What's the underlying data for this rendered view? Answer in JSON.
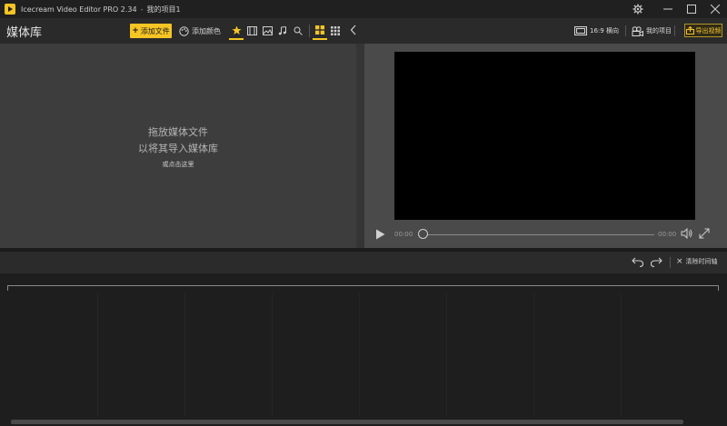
{
  "window": {
    "app_title": "Icecream Video Editor PRO 2.34",
    "separator": "-",
    "project_name": "我的项目1"
  },
  "library": {
    "title": "媒体库",
    "add_file_label": "添加文件",
    "add_color_label": "添加颜色",
    "drop_line1": "拖放媒体文件",
    "drop_line2": "以将其导入媒体库",
    "click_here": "或点击这里"
  },
  "preview": {
    "aspect_label": "16:9 横向",
    "project_label": "我的项目",
    "export_label": "导出视频",
    "time_start": "00:00",
    "time_end": "00:00",
    "progress": 0
  },
  "timeline": {
    "clear_label": "清除时间轴"
  },
  "colors": {
    "accent": "#f6c524",
    "panel_dark": "#2a2a2a",
    "library_bg": "#3d3d3d",
    "preview_bg": "#4a4a4a"
  }
}
